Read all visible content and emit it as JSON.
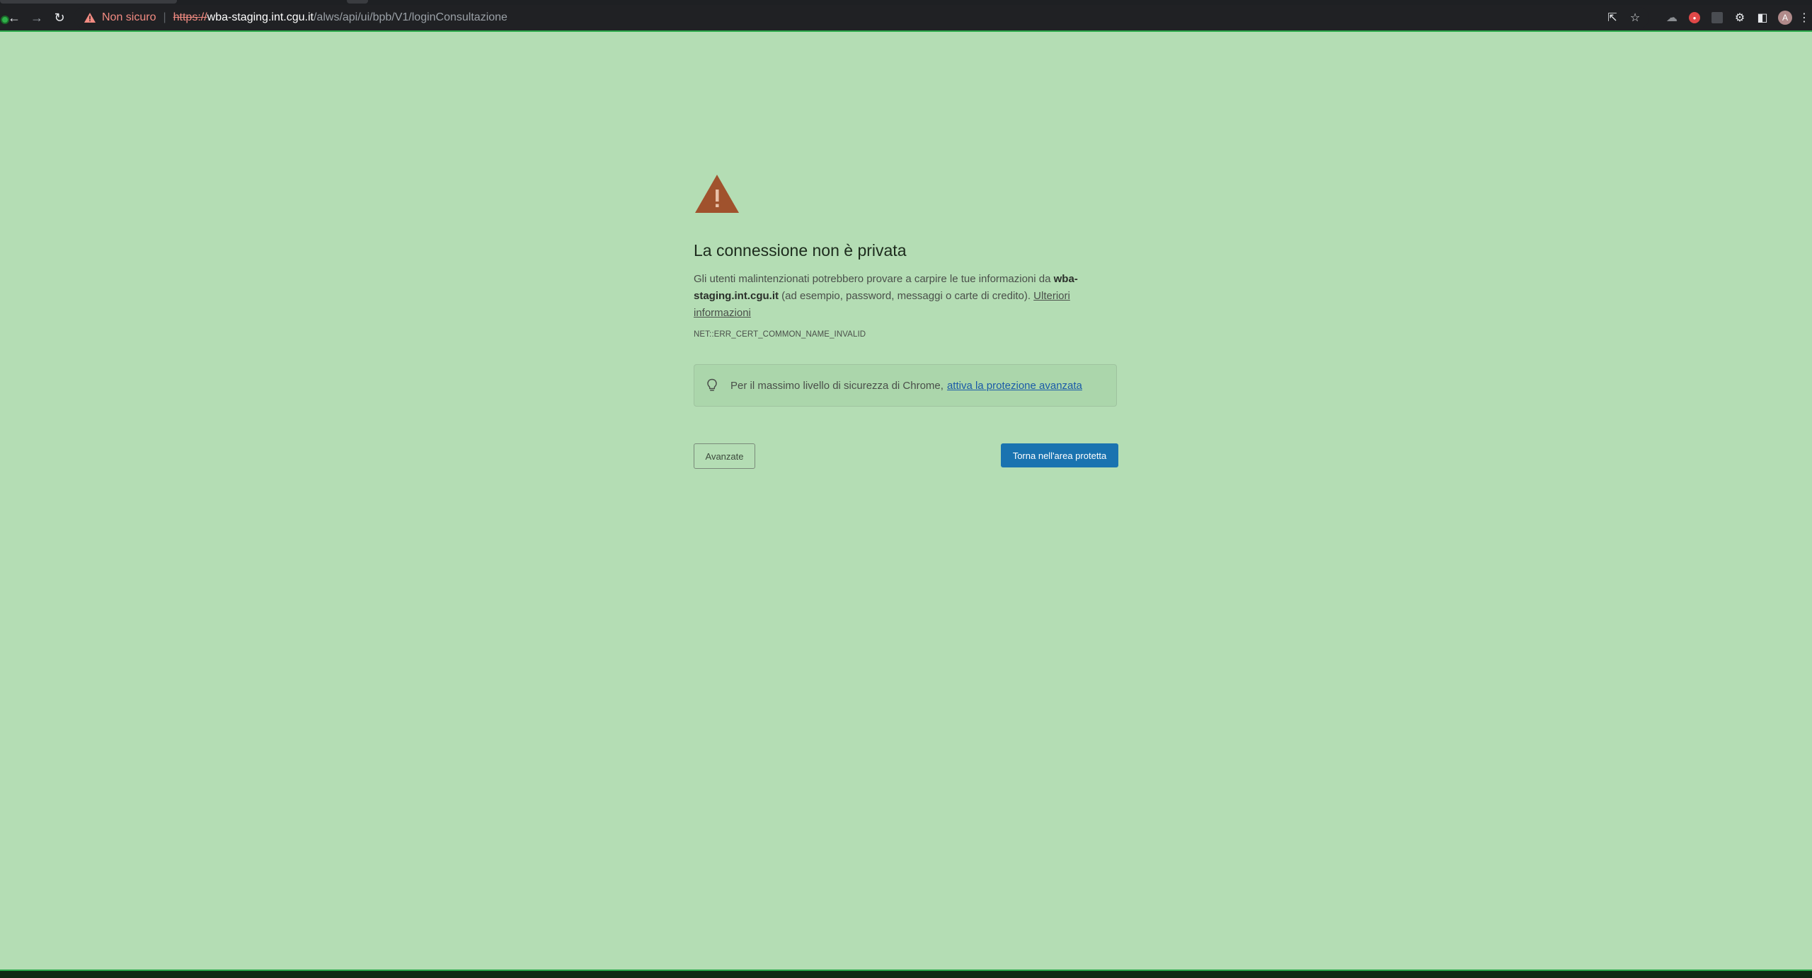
{
  "browser": {
    "security_label": "Non sicuro",
    "url_scheme": "https://",
    "url_host": "wba-staging.int.cgu.it",
    "url_path": "/alws/api/ui/bpb/V1/loginConsultazione",
    "profile_initial": "A",
    "colors": {
      "toolbar_bg": "#202124",
      "not_secure": "#f28b82"
    }
  },
  "page": {
    "title": "La connessione non è privata",
    "desc_before_host": "Gli utenti malintenzionati potrebbero provare a carpire le tue informazioni da ",
    "desc_host": "wba-staging.int.cgu.it",
    "desc_after_host": " (ad esempio, password, messaggi o carte di credito). ",
    "more_info_link": "Ulteriori informazioni",
    "error_code": "NET::ERR_CERT_COMMON_NAME_INVALID",
    "tip_text": "Per il massimo livello di sicurezza di Chrome,",
    "tip_link": "attiva la protezione avanzata",
    "advanced_button": "Avanzate",
    "back_button": "Torna nell'area protetta",
    "colors": {
      "background": "#b4ddb4",
      "warning_icon": "#a0522d",
      "primary_button": "#1a73b0",
      "link": "#1a5aa8"
    }
  }
}
